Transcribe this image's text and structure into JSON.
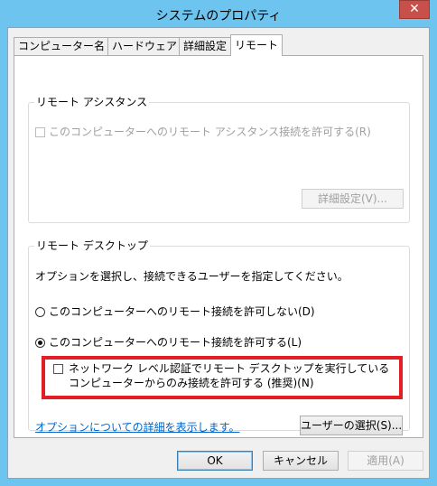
{
  "window": {
    "title": "システムのプロパティ",
    "close_glyph": "✕"
  },
  "tabs": [
    {
      "label": "コンピューター名",
      "active": false
    },
    {
      "label": "ハードウェア",
      "active": false
    },
    {
      "label": "詳細設定",
      "active": false
    },
    {
      "label": "リモート",
      "active": true
    }
  ],
  "remote_assistance": {
    "group_title": "リモート アシスタンス",
    "allow_label": "このコンピューターへのリモート アシスタンス接続を許可する(R)",
    "allow_checked": false,
    "advanced_button": "詳細設定(V)..."
  },
  "remote_desktop": {
    "group_title": "リモート デスクトップ",
    "instruction": "オプションを選択し、接続できるユーザーを指定してください。",
    "option_deny": "このコンピューターへのリモート接続を許可しない(D)",
    "option_allow": "このコンピューターへのリモート接続を許可する(L)",
    "selected": "allow",
    "nla_label": "ネットワーク レベル認証でリモート デスクトップを実行しているコンピューターからのみ接続を許可する (推奨)(N)",
    "nla_checked": false,
    "help_link": "オプションについての詳細を表示します。",
    "select_users_button": "ユーザーの選択(S)..."
  },
  "footer": {
    "ok": "OK",
    "cancel": "キャンセル",
    "apply": "適用(A)"
  },
  "colors": {
    "titlebar": "#6cc4ef",
    "close": "#c7504b",
    "highlight_border": "#e31e24",
    "link": "#0066cc"
  },
  "icons": {
    "close": "close-icon",
    "checkbox": "checkbox-icon",
    "radio": "radio-icon"
  }
}
